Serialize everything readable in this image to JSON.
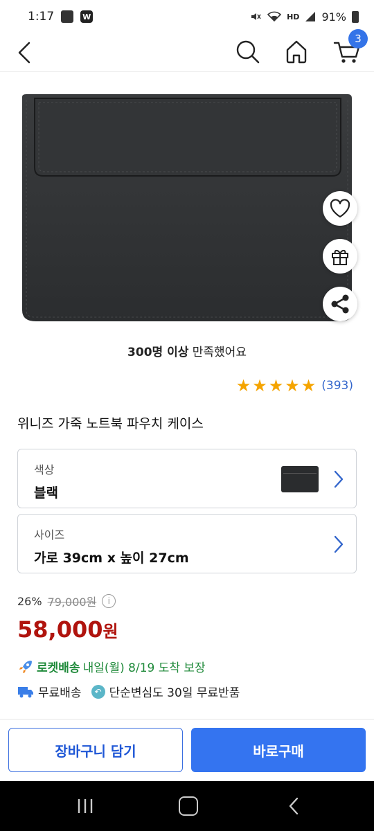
{
  "status_bar": {
    "time": "1:17",
    "network": "HD",
    "battery": "91%"
  },
  "header": {
    "cart_count": "3"
  },
  "product": {
    "satisfaction_bold": "300명 이상",
    "satisfaction_rest": " 만족했어요",
    "rating_stars": 5,
    "review_count": "(393)",
    "title": "위니즈 가죽 노트북 파우치 케이스"
  },
  "options": {
    "color": {
      "label": "색상",
      "value": "블랙"
    },
    "size": {
      "label": "사이즈",
      "value": "가로 39cm x 높이 27cm"
    }
  },
  "price": {
    "discount": "26%",
    "original": "79,000원",
    "sale_number": "58,000",
    "sale_unit": "원"
  },
  "delivery": {
    "rocket_label": "로켓배송",
    "rocket_info": " 내일(월) 8/19 도착 보장",
    "free_shipping": "무료배송",
    "free_return": "단순변심도 30일 무료반품"
  },
  "actions": {
    "add_to_cart": "장바구니 담기",
    "buy_now": "바로구매"
  },
  "colors": {
    "accent": "#3474f0",
    "price_red": "#b0140e",
    "rocket_green": "#1f8a3a",
    "star": "#f5a400"
  },
  "icons": [
    "back-icon",
    "search-icon",
    "home-icon",
    "cart-icon",
    "heart-icon",
    "gift-icon",
    "share-icon",
    "chevron-right-icon",
    "info-icon",
    "rocket-icon",
    "truck-icon",
    "return-icon"
  ]
}
